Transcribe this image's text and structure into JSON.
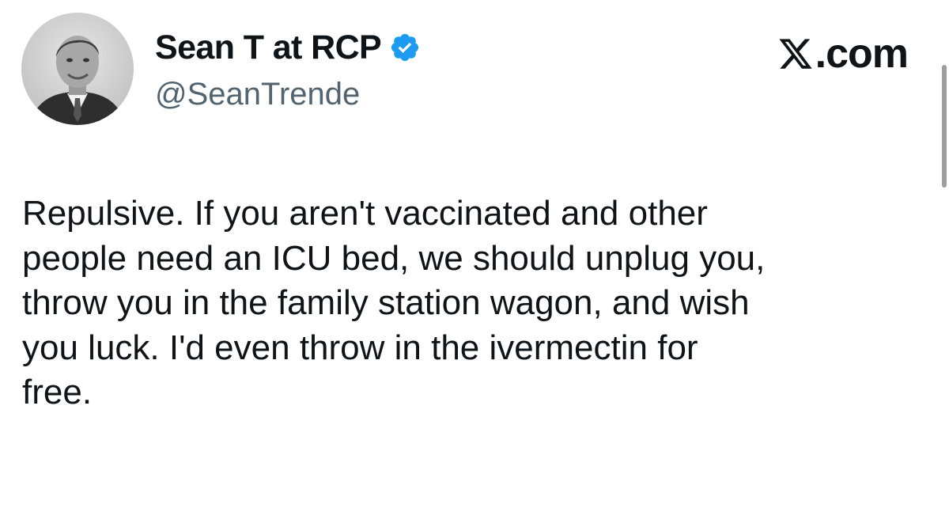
{
  "tweet": {
    "author": {
      "display_name": "Sean T at RCP",
      "handle": "@SeanTrende",
      "verified": true,
      "avatar_icon": "avatar-photo"
    },
    "source": {
      "text": "com",
      "icon": "x-logo-icon"
    },
    "text": "Repulsive. If you aren't vaccinated and other\npeople need an ICU bed, we should unplug you,\nthrow you in the family station wagon, and wish\nyou luck. I'd even throw in the ivermectin for\nfree."
  },
  "colors": {
    "text_primary": "#0f1419",
    "text_secondary": "#536471",
    "verified_blue": "#1d9bf0",
    "background": "#ffffff"
  }
}
